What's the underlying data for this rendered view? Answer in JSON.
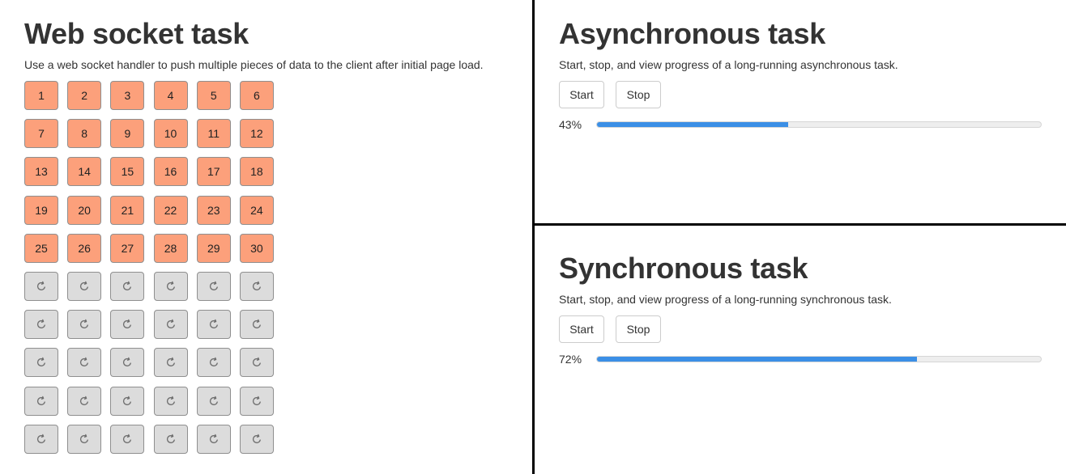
{
  "websocket": {
    "title": "Web socket task",
    "description": "Use a web socket handler to push multiple pieces of data to the client after initial page load.",
    "loaded_cells": [
      "1",
      "2",
      "3",
      "4",
      "5",
      "6",
      "7",
      "8",
      "9",
      "10",
      "11",
      "12",
      "13",
      "14",
      "15",
      "16",
      "17",
      "18",
      "19",
      "20",
      "21",
      "22",
      "23",
      "24",
      "25",
      "26",
      "27",
      "28",
      "29",
      "30"
    ],
    "pending_cell_count": 30,
    "pending_icon": "refresh-icon",
    "colors": {
      "loaded": "#fca07b",
      "pending": "#dcdcdc"
    }
  },
  "async_task": {
    "title": "Asynchronous task",
    "description": "Start, stop, and view progress of a long-running asynchronous task.",
    "start_label": "Start",
    "stop_label": "Stop",
    "progress_label": "43%",
    "progress_value": 43
  },
  "sync_task": {
    "title": "Synchronous task",
    "description": "Start, stop, and view progress of a long-running synchronous task.",
    "start_label": "Start",
    "stop_label": "Stop",
    "progress_label": "72%",
    "progress_value": 72
  },
  "colors": {
    "progress_fill": "#3b8fe6",
    "divider": "#000000"
  }
}
